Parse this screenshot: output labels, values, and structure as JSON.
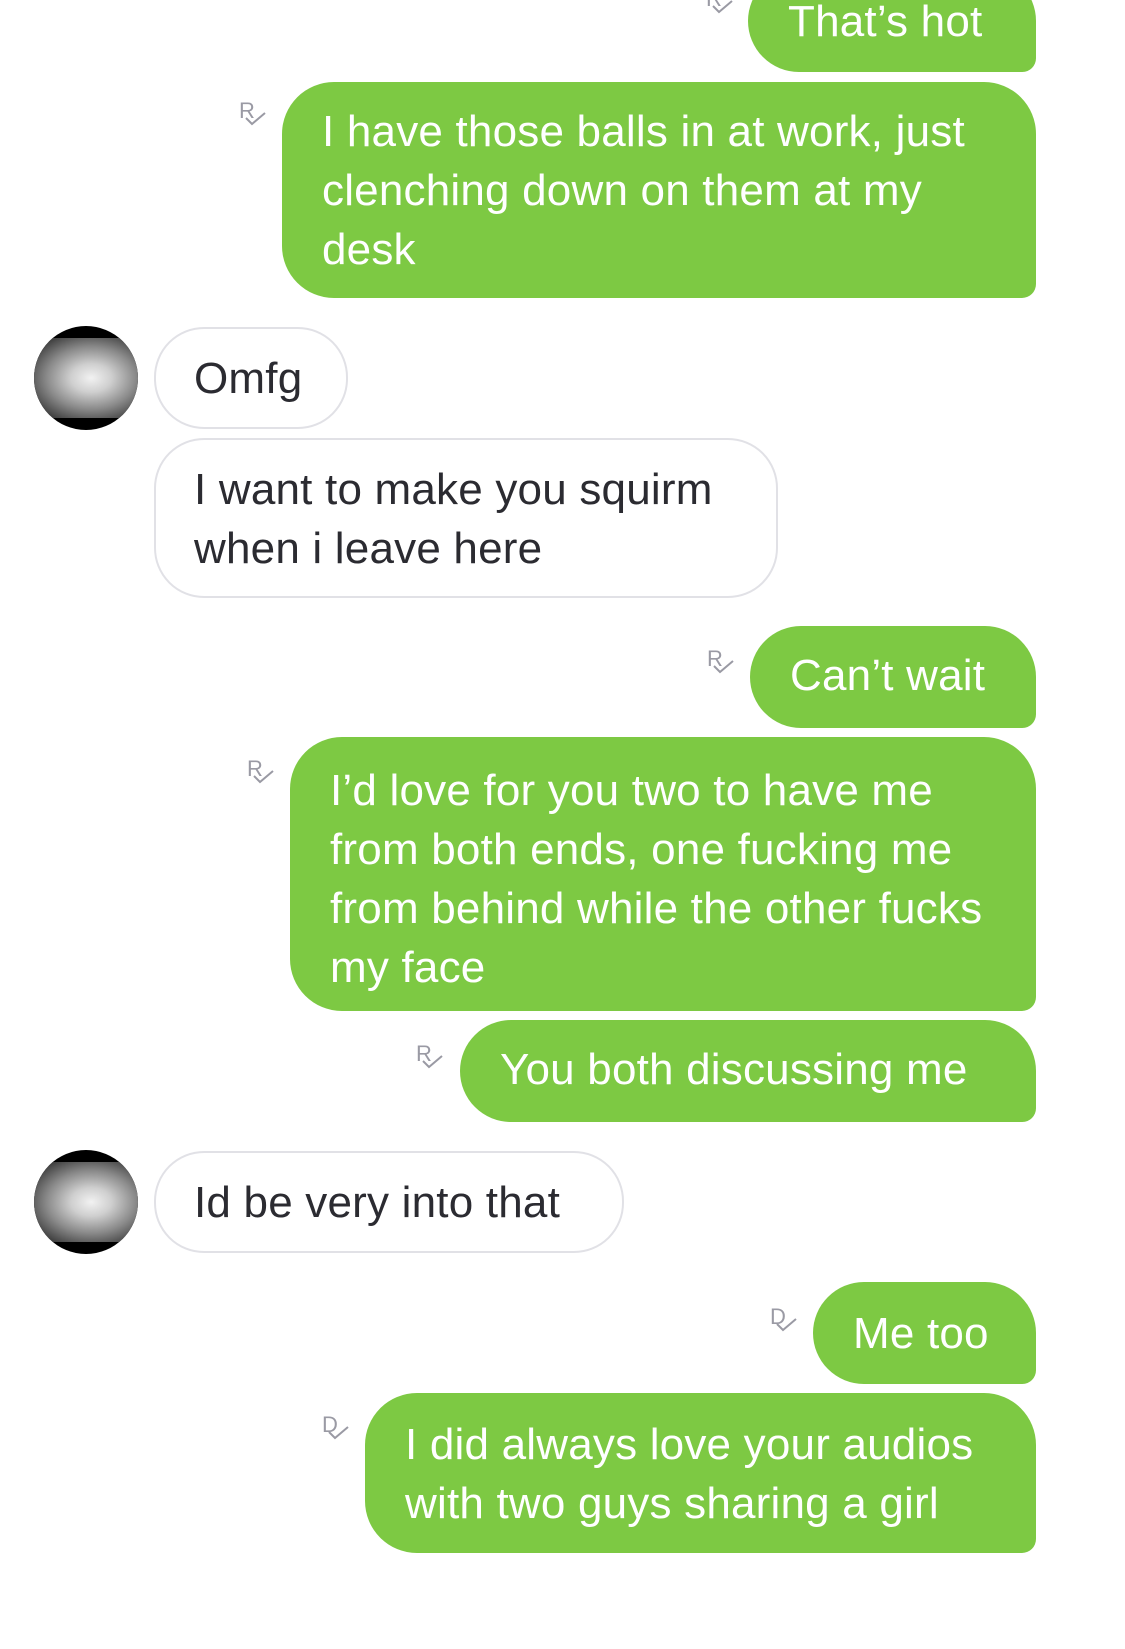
{
  "colors": {
    "outgoing_bubble": "#7dc943",
    "incoming_border": "#e1e1e6",
    "status_icon": "#9a9aa4"
  },
  "messages": [
    {
      "side": "out",
      "text": "That’s hot",
      "status": "R"
    },
    {
      "side": "out",
      "text": "I have those balls in at work, just clenching down on them at my desk",
      "status": "R"
    },
    {
      "side": "in",
      "text": "Omfg"
    },
    {
      "side": "in",
      "text": "I want to make you squirm when i leave here"
    },
    {
      "side": "out",
      "text": "Can’t wait",
      "status": "R"
    },
    {
      "side": "out",
      "text": "I’d love for you two to have me from both ends, one fucking me from behind while the other fucks my face",
      "status": "R"
    },
    {
      "side": "out",
      "text": "You both discussing me",
      "status": "R"
    },
    {
      "side": "in",
      "text": "Id be very into that"
    },
    {
      "side": "out",
      "text": "Me too",
      "status": "D"
    },
    {
      "side": "out",
      "text": "I did always love your audios with two guys sharing a girl",
      "status": "D"
    }
  ],
  "icons": {
    "avatar": "contact-avatar",
    "status": "receipt-check-icon"
  }
}
